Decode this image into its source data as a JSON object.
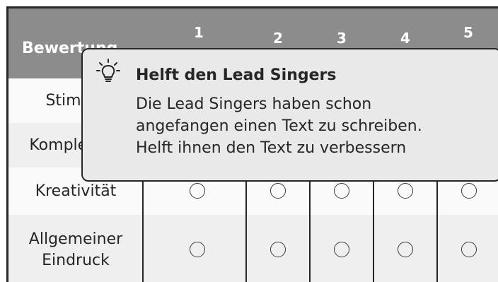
{
  "table": {
    "header_label": "Bewertung",
    "columns": [
      "1",
      "2",
      "3",
      "4",
      "5"
    ],
    "rows": [
      {
        "label": "Stimme"
      },
      {
        "label": "Komplexität"
      },
      {
        "label": "Kreativität"
      },
      {
        "label_line1": "Allgemeiner",
        "label_line2": "Eindruck"
      }
    ]
  },
  "tooltip": {
    "icon": "lightbulb-icon",
    "title": "Helft den Lead Singers",
    "body_lines": [
      "Die Lead Singers haben schon",
      "angefangen einen Text zu schreiben.",
      "Helft ihnen den Text zu verbessern"
    ]
  }
}
